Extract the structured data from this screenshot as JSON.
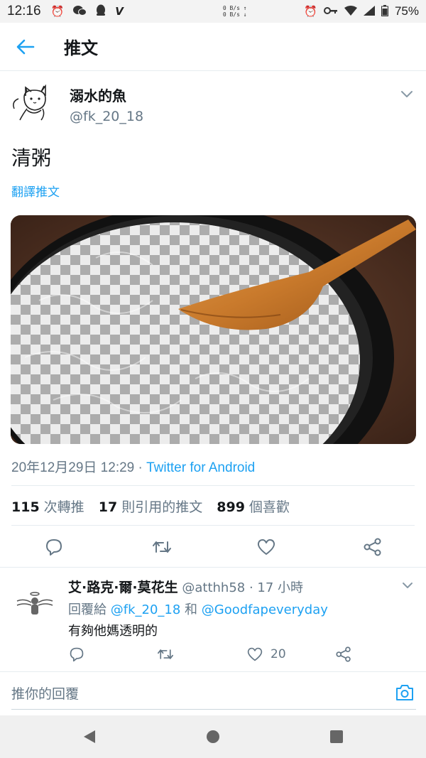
{
  "status_bar": {
    "time": "12:16",
    "net_up": "0 B/s",
    "net_down": "0 B/s",
    "battery": "75%"
  },
  "header": {
    "title": "推文"
  },
  "tweet": {
    "display_name": "溺水的魚",
    "handle": "@fk_20_18",
    "text": "清粥",
    "translate_label": "翻譯推文",
    "timestamp": "20年12月29日 12:29 · ",
    "source": "Twitter for Android",
    "stats": {
      "retweets_count": "115",
      "retweets_label": "次轉推",
      "quotes_count": "17",
      "quotes_label": "則引用的推文",
      "likes_count": "899",
      "likes_label": "個喜歡"
    }
  },
  "reply": {
    "display_name": "艾·路克·爾·莫花生",
    "handle_time": " @atthh58 · 17 小時",
    "reply_to_prefix": "回覆給 ",
    "mention_1": "@fk_20_18",
    "conjunction": " 和 ",
    "mention_2": "@Goodfapeveryday",
    "text": "有夠他媽透明的",
    "like_count": "20"
  },
  "compose": {
    "placeholder": "推你的回覆"
  },
  "colors": {
    "accent": "#1da1f2",
    "secondary_text": "#657786",
    "divider": "#e6ecf0"
  }
}
